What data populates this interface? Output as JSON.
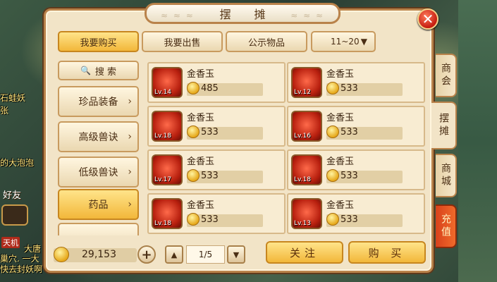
{
  "window": {
    "title": "摆 摊"
  },
  "tabs": [
    {
      "label": "我要购买",
      "active": true
    },
    {
      "label": "我要出售",
      "active": false
    },
    {
      "label": "公示物品",
      "active": false
    }
  ],
  "level_range": {
    "value": "11~20",
    "arrow": "▼"
  },
  "search": {
    "icon": "search-icon",
    "glyph": "🔍",
    "label": "搜 索"
  },
  "categories": [
    {
      "label": "珍品装备",
      "active": false
    },
    {
      "label": "高级兽诀",
      "active": false
    },
    {
      "label": "低级兽诀",
      "active": false
    },
    {
      "label": "药品",
      "active": true
    }
  ],
  "items": [
    {
      "name": "金香玉",
      "level": "Lv.14",
      "price": "485"
    },
    {
      "name": "金香玉",
      "level": "Lv.12",
      "price": "533"
    },
    {
      "name": "金香玉",
      "level": "Lv.18",
      "price": "533"
    },
    {
      "name": "金香玉",
      "level": "Lv.16",
      "price": "533"
    },
    {
      "name": "金香玉",
      "level": "Lv.17",
      "price": "533"
    },
    {
      "name": "金香玉",
      "level": "Lv.18",
      "price": "533"
    },
    {
      "name": "金香玉",
      "level": "Lv.18",
      "price": "533"
    },
    {
      "name": "金香玉",
      "level": "Lv.13",
      "price": "533"
    }
  ],
  "footer": {
    "money": "29,153",
    "plus": "+",
    "prev": "▲",
    "next": "▼",
    "page": "1/5",
    "follow_label": "关注",
    "buy_label": "购 买"
  },
  "side_tabs": [
    {
      "label": "商会"
    },
    {
      "label": "摆摊"
    },
    {
      "label": "商城"
    },
    {
      "label": "充值"
    }
  ],
  "close_glyph": "✕",
  "background_text": {
    "line1": "石蛙妖",
    "line2": "张",
    "line3": "的大泡泡",
    "friend": "好友",
    "quest_tag": "天机",
    "line4": "大唐",
    "line5": "巢穴. 一大",
    "line6": "快去封妖啊"
  }
}
